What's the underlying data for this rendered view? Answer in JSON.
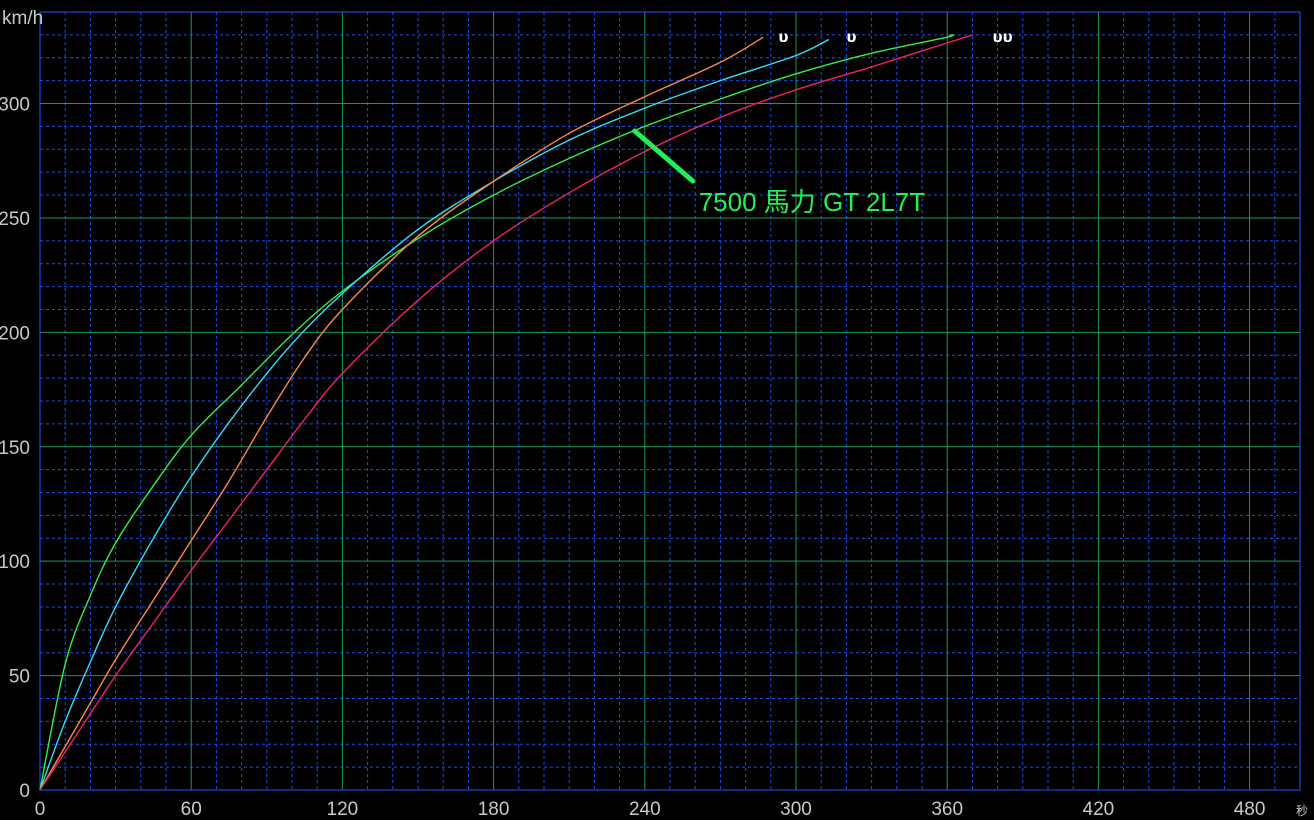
{
  "chart_data": {
    "type": "line",
    "title": "",
    "xlabel": "秒",
    "ylabel": "km/h",
    "xlim": [
      0,
      500
    ],
    "ylim": [
      0,
      340
    ],
    "x_ticks": [
      0,
      60,
      120,
      180,
      240,
      300,
      360,
      420,
      480
    ],
    "y_ticks": [
      0,
      50,
      100,
      150,
      200,
      250,
      300
    ],
    "grid": true,
    "legend": "none",
    "series": [
      {
        "color": "#33ee44",
        "points": [
          [
            0,
            0
          ],
          [
            10,
            55
          ],
          [
            20,
            85
          ],
          [
            30,
            108
          ],
          [
            45,
            133
          ],
          [
            60,
            155
          ],
          [
            80,
            177
          ],
          [
            100,
            199
          ],
          [
            120,
            218
          ],
          [
            150,
            241
          ],
          [
            180,
            260
          ],
          [
            210,
            276
          ],
          [
            240,
            290
          ],
          [
            270,
            302
          ],
          [
            300,
            313
          ],
          [
            330,
            322
          ],
          [
            360,
            329
          ],
          [
            361,
            330
          ]
        ]
      },
      {
        "color": "#33ddff",
        "points": [
          [
            0,
            0
          ],
          [
            10,
            30
          ],
          [
            20,
            56
          ],
          [
            30,
            80
          ],
          [
            45,
            110
          ],
          [
            60,
            137
          ],
          [
            80,
            168
          ],
          [
            100,
            195
          ],
          [
            120,
            217
          ],
          [
            150,
            245
          ],
          [
            180,
            266
          ],
          [
            210,
            284
          ],
          [
            240,
            298
          ],
          [
            270,
            310
          ],
          [
            300,
            321
          ],
          [
            313,
            328
          ]
        ]
      },
      {
        "color": "#ff8844",
        "points": [
          [
            0,
            0
          ],
          [
            10,
            19
          ],
          [
            20,
            38
          ],
          [
            30,
            57
          ],
          [
            45,
            83
          ],
          [
            60,
            109
          ],
          [
            75,
            135
          ],
          [
            90,
            163
          ],
          [
            105,
            189
          ],
          [
            120,
            210
          ],
          [
            150,
            242
          ],
          [
            180,
            266
          ],
          [
            210,
            287
          ],
          [
            240,
            303
          ],
          [
            270,
            318
          ],
          [
            287,
            329
          ]
        ]
      },
      {
        "color": "#ee2266",
        "points": [
          [
            0,
            0
          ],
          [
            15,
            25
          ],
          [
            30,
            50
          ],
          [
            45,
            73
          ],
          [
            60,
            96
          ],
          [
            75,
            118
          ],
          [
            90,
            140
          ],
          [
            105,
            162
          ],
          [
            120,
            182
          ],
          [
            150,
            214
          ],
          [
            180,
            240
          ],
          [
            210,
            261
          ],
          [
            240,
            279
          ],
          [
            270,
            294
          ],
          [
            300,
            306
          ],
          [
            330,
            316
          ],
          [
            350,
            323
          ],
          [
            370,
            330
          ]
        ]
      }
    ],
    "annotations": [
      {
        "text": "7500 馬力 GT  2L7T",
        "color": "#22ee55",
        "target": [
          236,
          288
        ]
      },
      {
        "text": "υ",
        "at_x": 293,
        "at_y": 329
      },
      {
        "text": "υ",
        "at_x": 320,
        "at_y": 329
      },
      {
        "text": "υυ",
        "at_x": 378,
        "at_y": 329
      }
    ]
  }
}
